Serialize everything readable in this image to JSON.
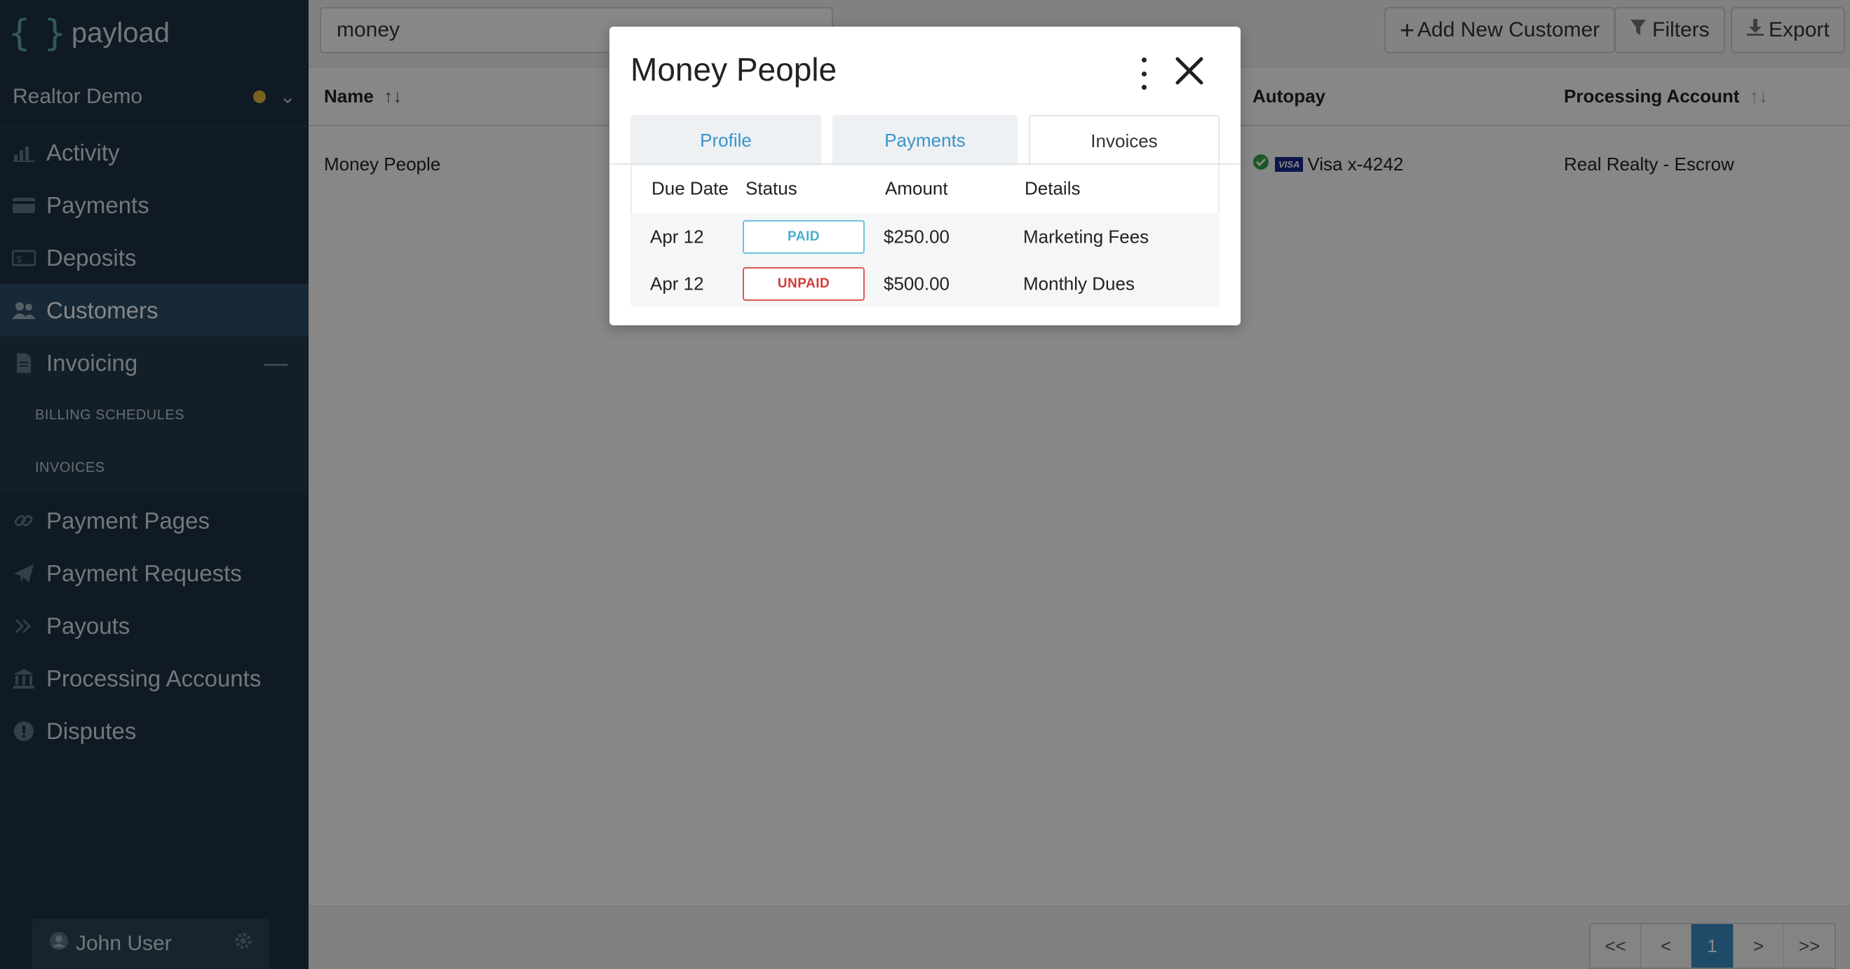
{
  "app": {
    "logo_text": "payload"
  },
  "org": {
    "name": "Realtor Demo",
    "status_color": "#e8b73a"
  },
  "sidebar": {
    "items": [
      {
        "label": "Activity",
        "icon": "bar-chart-icon"
      },
      {
        "label": "Payments",
        "icon": "credit-card-icon"
      },
      {
        "label": "Deposits",
        "icon": "cash-icon"
      },
      {
        "label": "Customers",
        "icon": "users-icon",
        "active": true
      },
      {
        "label": "Invoicing",
        "icon": "file-icon",
        "expanded": true
      },
      {
        "label": "Payment Pages",
        "icon": "link-icon"
      },
      {
        "label": "Payment Requests",
        "icon": "paper-plane-icon"
      },
      {
        "label": "Payouts",
        "icon": "double-chevron-icon"
      },
      {
        "label": "Processing Accounts",
        "icon": "bank-icon"
      },
      {
        "label": "Disputes",
        "icon": "alert-circle-icon"
      }
    ],
    "sub_items": [
      "BILLING SCHEDULES",
      "INVOICES"
    ],
    "user": "John User"
  },
  "toolbar": {
    "search_value": "money",
    "add_label": "Add New Customer",
    "filters_label": "Filters",
    "export_label": "Export"
  },
  "table": {
    "headers": {
      "name": "Name",
      "autopay": "Autopay",
      "processing": "Processing Account"
    },
    "rows": [
      {
        "name": "Money People",
        "autopay": "Visa x-4242",
        "card_brand": "VISA",
        "processing": "Real Realty - Escrow"
      }
    ]
  },
  "pager": {
    "first": "<<",
    "prev": "<",
    "current": "1",
    "next": ">",
    "last": ">>"
  },
  "modal": {
    "title": "Money People",
    "tabs": [
      "Profile",
      "Payments",
      "Invoices"
    ],
    "active_tab": "Invoices",
    "invoice_headers": [
      "Due Date",
      "Status",
      "Amount",
      "Details"
    ],
    "invoices": [
      {
        "due": "Apr 12",
        "status": "PAID",
        "amount": "$250.00",
        "details": "Marketing Fees"
      },
      {
        "due": "Apr 12",
        "status": "UNPAID",
        "amount": "$500.00",
        "details": "Monthly Dues"
      }
    ]
  },
  "colors": {
    "sidebar": "#1d3244",
    "accent": "#3a93c9",
    "paid": "#4aaed0",
    "unpaid": "#d33b3b",
    "success": "#3aa54a"
  }
}
